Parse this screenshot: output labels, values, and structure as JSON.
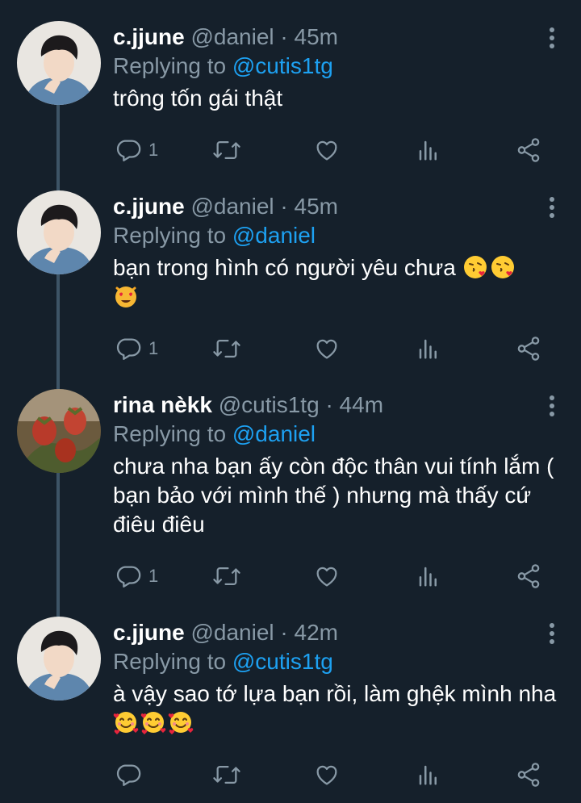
{
  "tweets": [
    {
      "name": "c.jjune",
      "handle": "@daniel",
      "time": "45m",
      "replying_prefix": "Replying to",
      "replying_to": "@cutis1tg",
      "text": "trông tốn gái thật",
      "reply_count": "1",
      "avatar": "portrait-boy"
    },
    {
      "name": "c.jjune",
      "handle": "@daniel",
      "time": "45m",
      "replying_prefix": "Replying to",
      "replying_to": "@daniel",
      "text": "bạn trong hình có người yêu chưa",
      "emojis": [
        "face-blowing-kiss-emoji",
        "face-blowing-kiss-emoji",
        "heart-eyes-cat-emoji"
      ],
      "reply_count": "1",
      "avatar": "portrait-boy"
    },
    {
      "name": "rina nèkk",
      "handle": "@cutis1tg",
      "time": "44m",
      "replying_prefix": "Replying to",
      "replying_to": "@daniel",
      "text": "chưa nha bạn ấy còn độc thân vui tính lắm ( bạn bảo với mình thế ) nhưng mà thấy cứ điêu điêu",
      "reply_count": "1",
      "avatar": "strawberries"
    },
    {
      "name": "c.jjune",
      "handle": "@daniel",
      "time": "42m",
      "replying_prefix": "Replying to",
      "replying_to": "@cutis1tg",
      "text": "à vậy sao tớ lựa bạn rồi, làm ghệk mình nha",
      "emojis": [
        "smiling-face-with-hearts-emoji",
        "smiling-face-with-hearts-emoji",
        "smiling-face-with-hearts-emoji"
      ],
      "reply_count": "",
      "avatar": "portrait-boy"
    }
  ],
  "separator": "·",
  "colors": {
    "background": "#15202b",
    "text_primary": "#ffffff",
    "text_secondary": "#8899a6",
    "link": "#1da1f2",
    "thread_line": "#3d5466"
  }
}
